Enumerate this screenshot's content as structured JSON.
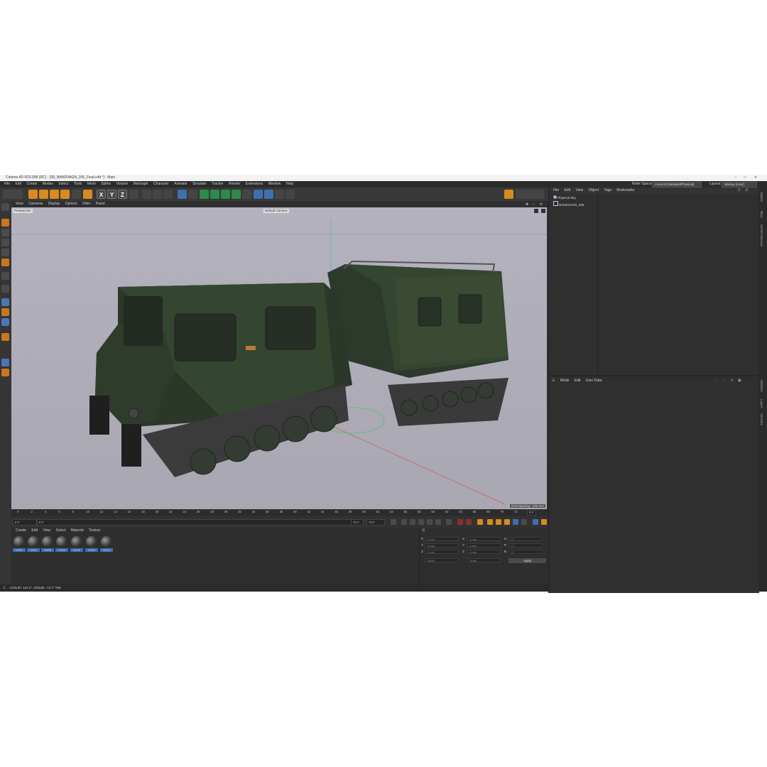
{
  "window": {
    "title": "Cinema 4D R23.008 (RC) - [3D_BANDVAGN_206_Final.c4d *] - Main"
  },
  "menubar": {
    "items": [
      "File",
      "Edit",
      "Create",
      "Modes",
      "Select",
      "Tools",
      "Mesh",
      "Spline",
      "Volume",
      "MoGraph",
      "Character",
      "Animate",
      "Simulate",
      "Tracker",
      "Render",
      "Extensions",
      "Window",
      "Help"
    ],
    "node_space_label": "Node Space:",
    "node_space_value": "Current (Standard/Physical)",
    "layout_label": "Layout:",
    "layout_value": "Startup (User)"
  },
  "toolbar": {
    "xyz": [
      "X",
      "Y",
      "Z"
    ]
  },
  "viewport": {
    "menu": [
      "View",
      "Cameras",
      "Display",
      "Options",
      "Filter",
      "Panel"
    ],
    "view_name": "Perspective",
    "camera": "Default Camera",
    "grid_spacing": "Grid Spacing : 100 mm"
  },
  "timeline": {
    "ticks": [
      "0",
      "2",
      "4",
      "6",
      "8",
      "10",
      "12",
      "14",
      "16",
      "18",
      "20",
      "22",
      "24",
      "26",
      "28",
      "30",
      "32",
      "34",
      "36",
      "38",
      "40",
      "42",
      "44",
      "46",
      "48",
      "50",
      "52",
      "54",
      "56",
      "58",
      "60",
      "62",
      "64",
      "66",
      "68",
      "70",
      "72"
    ],
    "current_frame": "0 F",
    "start_field": "0 F",
    "min_field": "0 F",
    "end_field": "72 F",
    "max_field": "72 F"
  },
  "materials": {
    "menu": [
      "Create",
      "Edit",
      "View",
      "Select",
      "Material",
      "Texture"
    ],
    "items": [
      "UV01",
      "UV02",
      "UV03",
      "UV04",
      "UV11",
      "UV12",
      "UV13"
    ]
  },
  "coordinates": {
    "rows": [
      {
        "axis": "X",
        "pos": "0 mm",
        "rot_axis": "X",
        "rot": "0 mm",
        "size_axis": "H",
        "size": "0 °"
      },
      {
        "axis": "Y",
        "pos": "0 mm",
        "rot_axis": "Y",
        "rot": "0 mm",
        "size_axis": "P",
        "size": "0 °"
      },
      {
        "axis": "Z",
        "pos": "0 mm",
        "rot_axis": "Z",
        "rot": "0 mm",
        "size_axis": "B",
        "size": "0 °"
      }
    ],
    "mode": "World",
    "scale": "Scale",
    "apply": "Apply"
  },
  "status": {
    "text": "Azimuth: 124.4°, Altitude: -13.7° NW"
  },
  "objects": {
    "menu": [
      "File",
      "Edit",
      "View",
      "Object",
      "Tags",
      "Bookmarks"
    ],
    "items": [
      "Physical Sky",
      "BANDVAGN_206"
    ]
  },
  "attributes": {
    "menu": [
      "Mode",
      "Edit",
      "User Data"
    ]
  },
  "side_tabs": {
    "top": [
      "Objects",
      "Takes",
      "Content Browser"
    ],
    "bottom": [
      "Attributes",
      "Layers",
      "Structure"
    ]
  },
  "colors": {
    "accent_orange": "#d98a20",
    "accent_blue": "#3e6fb0",
    "panel_bg": "#2f2f2f",
    "viewport_bg": "#b0afb9",
    "camo_green": "#2f3d2c"
  }
}
